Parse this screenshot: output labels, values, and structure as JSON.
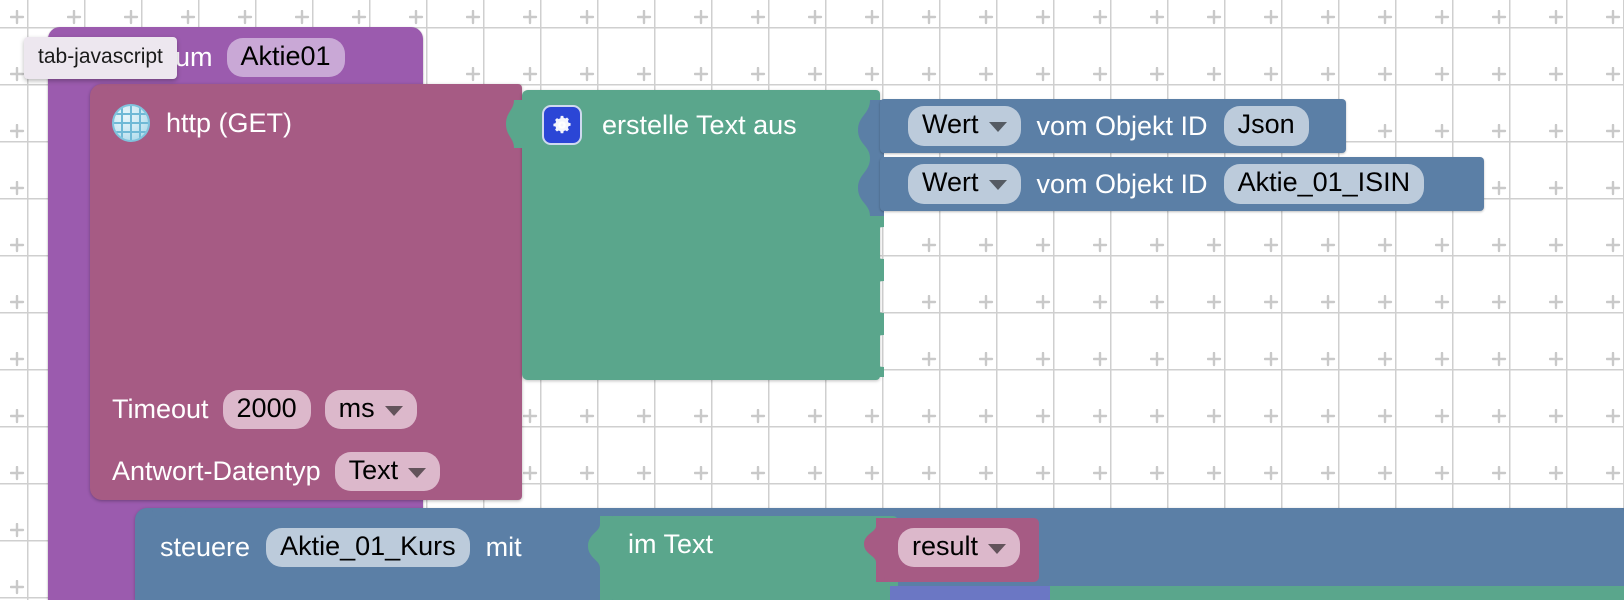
{
  "workspace": {
    "grid_color": "#cfcfcf",
    "background": "#ffffff"
  },
  "tooltip": {
    "text": "tab-javascript"
  },
  "blocks": {
    "event": {
      "color": "#9B5BAE",
      "label_suffix": "um",
      "field_value": "Aktie01",
      "icon_1": "blue-square-icon",
      "icon_2": "blue-square-icon"
    },
    "http": {
      "color": "#A65B84",
      "icon": "globe-icon",
      "title": "http (GET)",
      "timeout_label": "Timeout",
      "timeout_value": "2000",
      "timeout_unit": "ms",
      "datatype_label": "Antwort-Datentyp",
      "datatype_value": "Text"
    },
    "create_text": {
      "color": "#5AA68C",
      "icon": "gear-icon",
      "title": "erstelle Text aus",
      "empty_socket_count": 3
    },
    "value_rows": [
      {
        "dropdown": "Wert",
        "label": "vom Objekt ID",
        "object_id": "Json",
        "color": "#5B7FA6"
      },
      {
        "dropdown": "Wert",
        "label": "vom Objekt ID",
        "object_id": "Aktie_01_ISIN",
        "color": "#5B7FA6"
      }
    ],
    "control": {
      "color": "#5B7FA6",
      "verb": "steuere",
      "target": "Aktie_01_Kurs",
      "conjunction": "mit",
      "text_block_label": "im Text",
      "text_block_color": "#5AA68C",
      "result_field": "result",
      "result_color": "#A65B84"
    }
  }
}
